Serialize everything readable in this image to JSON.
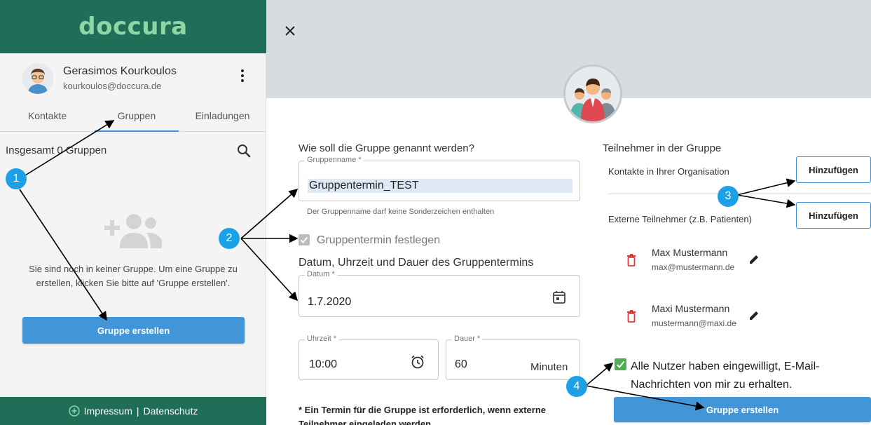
{
  "brand": {
    "logo": "doccura",
    "color": "#1f6e57",
    "logo_color": "#8ed6a5"
  },
  "profile": {
    "name": "Gerasimos Kourkoulos",
    "email": "kourkoulos@doccura.de",
    "avatar_icon": "user-avatar-icon",
    "menu_icon": "more-vert-icon"
  },
  "tabs": [
    {
      "label": "Kontakte",
      "active": false
    },
    {
      "label": "Gruppen",
      "active": true
    },
    {
      "label": "Einladungen",
      "active": false
    }
  ],
  "groups": {
    "count_text": "Insgesamt 0 Gruppen",
    "empty_text": "Sie sind noch in keiner Gruppe. Um eine Gruppe zu erstellen, klicken Sie bitte auf 'Gruppe erstellen'.",
    "create_button": "Gruppe erstellen"
  },
  "footer": {
    "impressum": "Impressum",
    "separator": "|",
    "datenschutz": "Datenschutz"
  },
  "dialog": {
    "name_question": "Wie soll die Gruppe genannt werden?",
    "name_legend": "Gruppenname *",
    "name_value": "Gruppentermin_TEST",
    "name_hint": "Der Gruppenname darf keine Sonderzeichen enthalten",
    "termin_checkbox_label": "Gruppentermin festlegen",
    "termin_checked": true,
    "datetime_title": "Datum, Uhrzeit und Dauer des Gruppentermins",
    "date_legend": "Datum *",
    "date_value": "1.7.2020",
    "time_legend": "Uhrzeit *",
    "time_value": "10:00",
    "duration_legend": "Dauer *",
    "duration_value": "60",
    "duration_unit": "Minuten",
    "required_note": "* Ein Termin für die Gruppe ist erforderlich, wenn externe Teilnehmer eingeladen werden",
    "members_title": "Teilnehmer in der Gruppe",
    "internal_label": "Kontakte in Ihrer Organisation",
    "add_button": "Hinzufügen",
    "external_label": "Externe Teilnehmer (z.B. Patienten)",
    "participants": [
      {
        "name": "Max Mustermann",
        "email": "max@mustermann.de"
      },
      {
        "name": "Maxi Mustermann",
        "email": "mustermann@maxi.de"
      }
    ],
    "consent_text": "Alle Nutzer haben eingewilligt, E-Mail-Nachrichten von mir zu erhalten.",
    "consent_checked": true,
    "create_button": "Gruppe erstellen"
  },
  "annotations": {
    "badge_1": "1",
    "badge_2": "2",
    "badge_3": "3",
    "badge_4": "4",
    "badge_color": "#1da1e6"
  },
  "colors": {
    "accent": "#4296d8",
    "delete": "#e53935",
    "check_green": "#4caf50"
  }
}
